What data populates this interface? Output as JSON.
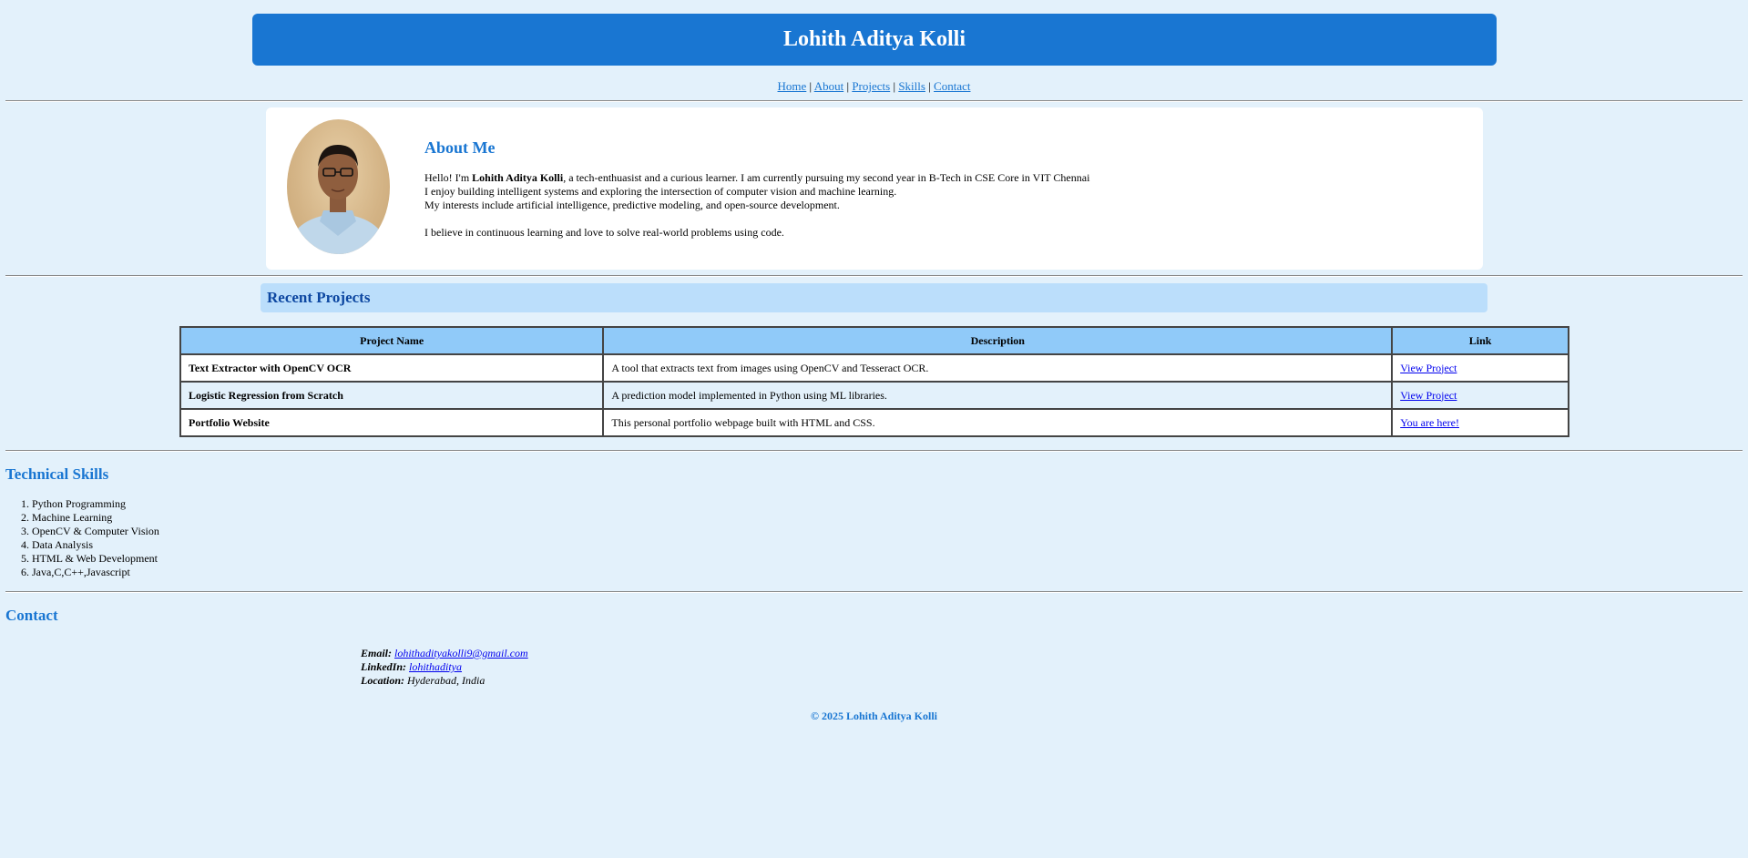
{
  "header": {
    "title": "Lohith Aditya Kolli"
  },
  "nav": {
    "items": [
      "Home",
      "About",
      "Projects",
      "Skills",
      "Contact"
    ],
    "separator": "|"
  },
  "about": {
    "title": "About Me",
    "intro_prefix": "Hello! I'm ",
    "intro_name": "Lohith Aditya Kolli",
    "intro_suffix": ", a tech-enthuasist and a curious learner. I am currently pursuing my second year in B-Tech in CSE Core in VIT Chennai",
    "line2": "I enjoy building intelligent systems and exploring the intersection of computer vision and machine learning.",
    "line3": "My interests include artificial intelligence, predictive modeling, and open-source development.",
    "line4": "I believe in continuous learning and love to solve real-world problems using code."
  },
  "projects": {
    "title": "Recent Projects",
    "headers": [
      "Project Name",
      "Description",
      "Link"
    ],
    "rows": [
      {
        "name": "Text Extractor with OpenCV OCR",
        "description": "A tool that extracts text from images using OpenCV and Tesseract OCR.",
        "link": "View Project"
      },
      {
        "name": "Logistic Regression from Scratch",
        "description": "A prediction model implemented in Python using ML libraries.",
        "link": "View Project"
      },
      {
        "name": "Portfolio Website",
        "description": "This personal portfolio webpage built with HTML and CSS.",
        "link": "You are here!"
      }
    ]
  },
  "skills": {
    "title": "Technical Skills",
    "items": [
      "Python Programming",
      "Machine Learning",
      "OpenCV & Computer Vision",
      "Data Analysis",
      "HTML & Web Development",
      "Java,C,C++,Javascript"
    ]
  },
  "contact": {
    "title": "Contact",
    "email_label": "Email:",
    "email": "lohithadityakolli9@gmail.com",
    "linkedin_label": "LinkedIn:",
    "linkedin": "lohithaditya",
    "location_label": "Location:",
    "location": "Hyderabad, India"
  },
  "footer": {
    "text": "© 2025 Lohith Aditya Kolli"
  },
  "colors": {
    "accent": "#1976d2",
    "background": "#e3f1fb",
    "table_header": "#90caf9"
  }
}
